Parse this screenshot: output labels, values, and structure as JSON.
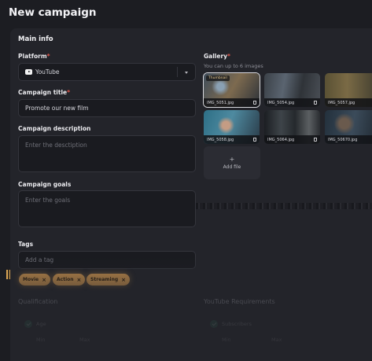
{
  "page": {
    "title": "New campaign"
  },
  "main_info": {
    "title": "Main info",
    "platform": {
      "label": "Platform",
      "required_mark": "*",
      "value": "YouTube",
      "icon": "youtube-icon"
    },
    "campaign_title": {
      "label": "Campaign title",
      "required_mark": "*",
      "value": "Promote our new film"
    },
    "description": {
      "label": "Campaign description",
      "placeholder": "Enter the desctiption"
    },
    "goals": {
      "label": "Campaign goals",
      "placeholder": "Enter the goals"
    },
    "tags": {
      "label": "Tags",
      "placeholder": "Add a tag",
      "items": [
        {
          "label": "Movie",
          "remove": "×"
        },
        {
          "label": "Action",
          "remove": "×"
        },
        {
          "label": "Streaming",
          "remove": "×"
        }
      ]
    }
  },
  "gallery": {
    "label": "Gallery",
    "required_mark": "*",
    "subtitle": "You can up to 6 images",
    "thumbnail_badge": "Thumbnail",
    "images": [
      {
        "name": "IMG_5051.jpg",
        "selected": true
      },
      {
        "name": "IMG_5054.jpg"
      },
      {
        "name": "IMG_5057.jpg"
      },
      {
        "name": "IMG_5058.jpg"
      },
      {
        "name": "IMG_5064.jpg"
      },
      {
        "name": "IMG_50670.jpg"
      }
    ],
    "add_file": {
      "icon": "+",
      "label": "Add file"
    }
  },
  "qualification": {
    "title": "Qualification",
    "option": "Age",
    "min_label": "Min",
    "max_label": "Max"
  },
  "youtube_requirements": {
    "title": "YouTube Requirements",
    "option": "Subscribers",
    "min_label": "Min",
    "max_label": "Max"
  },
  "colors": {
    "accent_tag": "#c58f4d",
    "background": "#1c1d22",
    "card": "#23242a",
    "check": "#2f7a5c"
  }
}
